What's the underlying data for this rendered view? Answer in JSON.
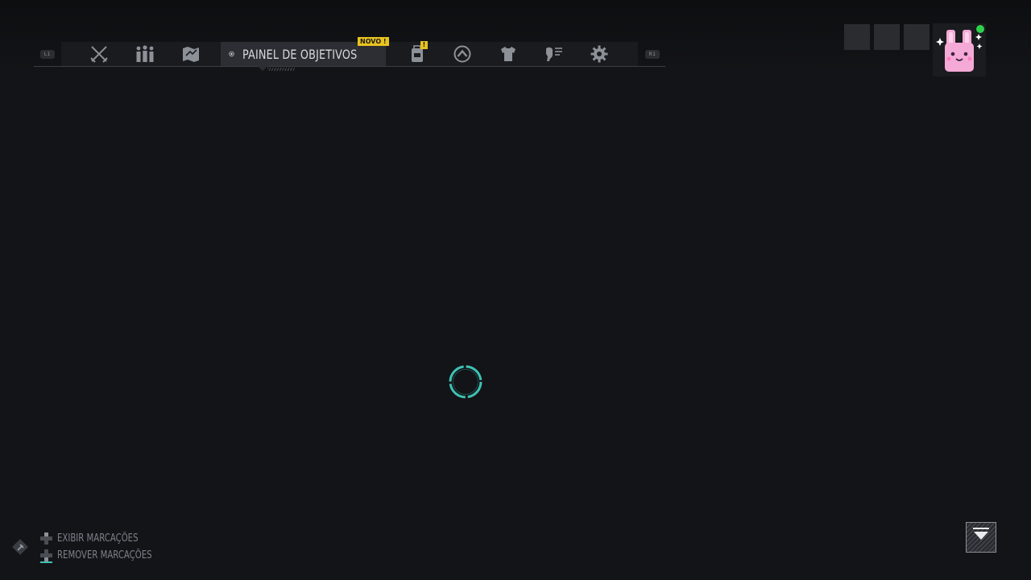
{
  "nav": {
    "left_bumper": "L1",
    "right_bumper": "R1",
    "active_tab_label": "PAINEL DE OBJETIVOS",
    "new_badge": "NOVO !",
    "alert_badge": "!",
    "tab_icons": [
      "crossed-swords-icon",
      "squad-icon",
      "map-icon",
      "objectives-target-icon",
      "backpack-icon",
      "rank-chevron-icon",
      "outfit-shirt-icon",
      "skills-icon",
      "settings-gear-icon"
    ]
  },
  "squad": {
    "slots": 3,
    "online_status": "online",
    "online_color": "#2ed14b",
    "avatar": "pink-bunny-avatar"
  },
  "loading": {
    "indicator": "loading-spinner-icon",
    "accent_color": "#3ec2b3"
  },
  "legend": {
    "show_markers": "EXIBIR MARCAÇÕES",
    "remove_markers": "REMOVER MARCAÇÕES"
  },
  "map_toggle": {
    "icon": "collapse-down-icon"
  }
}
